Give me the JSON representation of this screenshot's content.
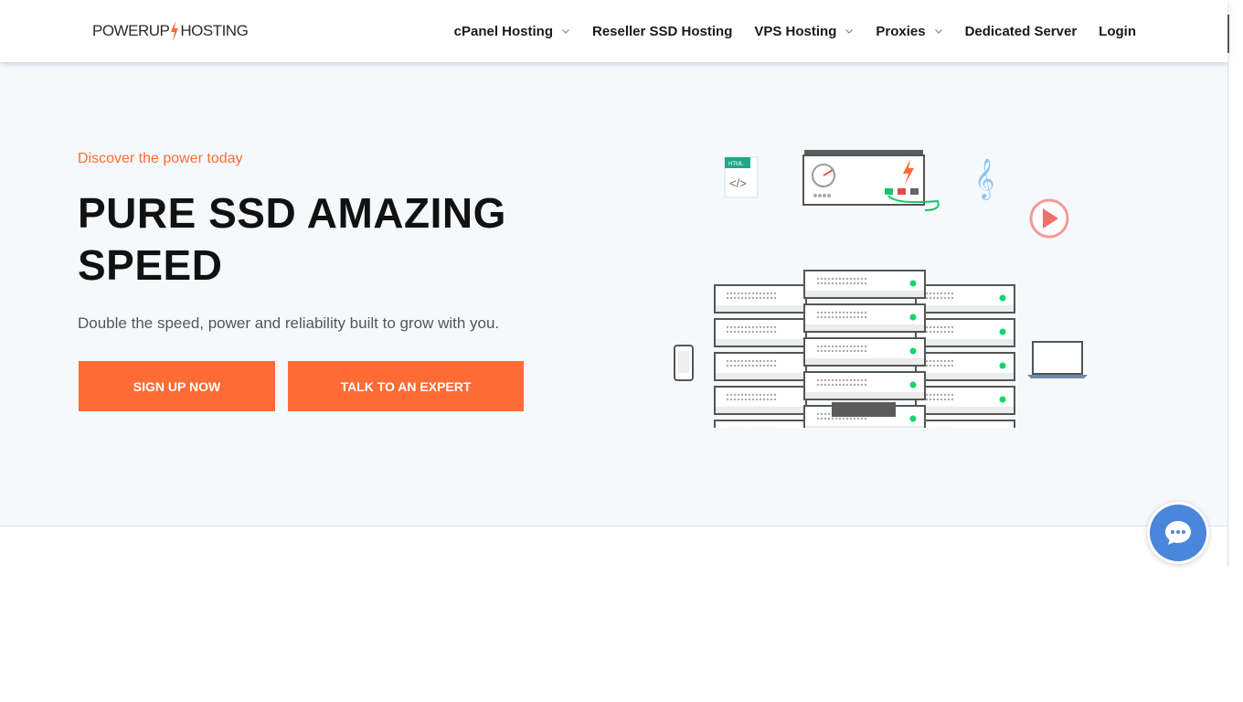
{
  "logo": {
    "text_left": "POWERUP",
    "text_right": "HOSTING"
  },
  "nav": {
    "items": [
      {
        "label": "cPanel Hosting",
        "dropdown": true
      },
      {
        "label": "Reseller SSD Hosting",
        "dropdown": false
      },
      {
        "label": "VPS Hosting",
        "dropdown": true
      },
      {
        "label": "Proxies",
        "dropdown": true
      },
      {
        "label": "Dedicated Server",
        "dropdown": false
      },
      {
        "label": "Login",
        "dropdown": false
      }
    ]
  },
  "hero": {
    "tagline": "Discover the power today",
    "title_line1": "PURE SSD AMAZING",
    "title_line2": "SPEED",
    "subtitle": "Double the speed, power and reliability built to grow with you.",
    "signup_label": "SIGN UP NOW",
    "expert_label": "TALK TO AN EXPERT",
    "html_badge": "HTML"
  },
  "colors": {
    "accent": "#ff6b35",
    "hero_bg": "#f6f9fc",
    "chat": "#4a86db",
    "led": "#19d36b"
  },
  "icons": [
    "chevron-down-icon",
    "bolt-icon",
    "speedometer-icon",
    "music-note-icon",
    "play-icon",
    "phone-icon",
    "laptop-icon",
    "code-file-icon",
    "chat-icon"
  ]
}
